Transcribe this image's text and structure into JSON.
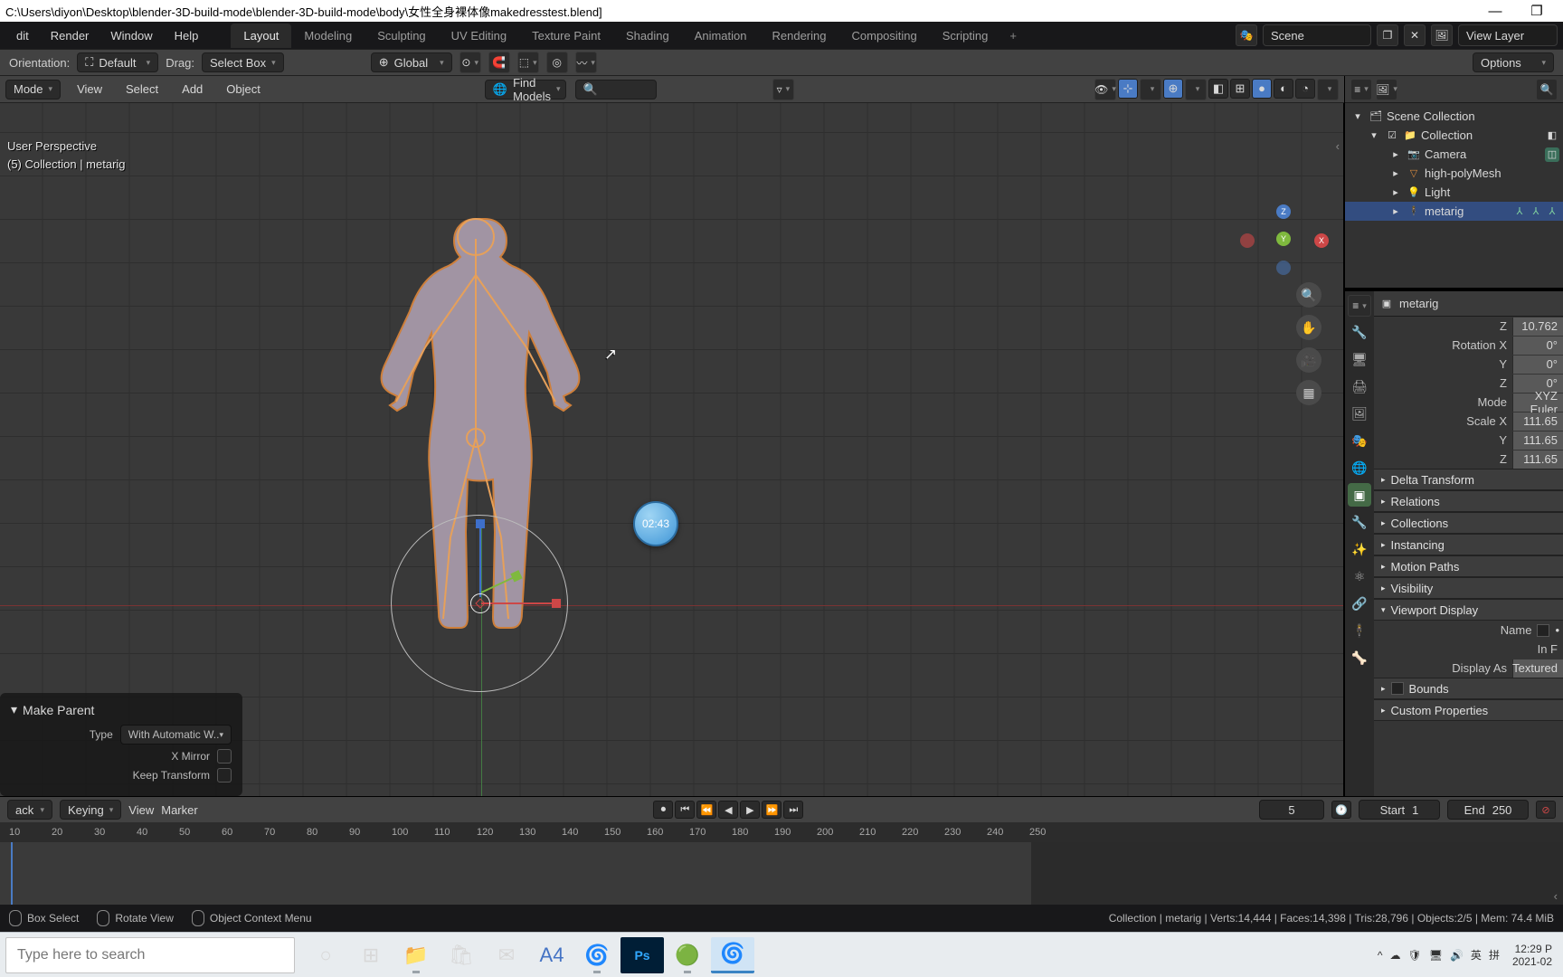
{
  "titlebar": {
    "path": "C:\\Users\\diyon\\Desktop\\blender-3D-build-mode\\blender-3D-build-mode\\body\\女性全身裸体像makedresstest.blend]",
    "minimize": "—",
    "maximize": "❐"
  },
  "topmenu": {
    "items": [
      "dit",
      "Render",
      "Window",
      "Help"
    ],
    "workspaces": [
      "Layout",
      "Modeling",
      "Sculpting",
      "UV Editing",
      "Texture Paint",
      "Shading",
      "Animation",
      "Rendering",
      "Compositing",
      "Scripting"
    ],
    "ws_add": "+",
    "scene_label": "Scene",
    "layer_label": "View Layer"
  },
  "toolsettings": {
    "orientation_label": "Orientation:",
    "orientation_value": "Default",
    "drag_label": "Drag:",
    "drag_value": "Select Box",
    "transform_value": "Global",
    "options_label": "Options"
  },
  "viewport_header": {
    "mode": "Mode",
    "menus": [
      "View",
      "Select",
      "Add",
      "Object"
    ],
    "find_label": "Find Models"
  },
  "viewport": {
    "persp": "User Perspective",
    "context": "(5) Collection | metarig",
    "timer": "02:43"
  },
  "nav_axes": {
    "x": "X",
    "y": "Y",
    "z": "Z"
  },
  "op_panel": {
    "title": "Make Parent",
    "type_label": "Type",
    "type_value": "With Automatic W..",
    "xmirror_label": "X Mirror",
    "keep_label": "Keep Transform"
  },
  "outliner": {
    "root": "Scene Collection",
    "coll": "Collection",
    "items": [
      {
        "name": "Camera",
        "icon": "camera"
      },
      {
        "name": "high-polyMesh",
        "icon": "mesh"
      },
      {
        "name": "Light",
        "icon": "light"
      },
      {
        "name": "metarig",
        "icon": "armature",
        "selected": true
      }
    ]
  },
  "properties": {
    "object_name": "metarig",
    "z_label": "Z",
    "z_value": "10.762",
    "rotx_label": "Rotation X",
    "rotx_value": "0°",
    "roty_label": "Y",
    "roty_value": "0°",
    "rotz_label": "Z",
    "rotz_value": "0°",
    "mode_label": "Mode",
    "mode_value": "XYZ Euler",
    "scalex_label": "Scale X",
    "scalex_value": "111.65",
    "scaley_label": "Y",
    "scaley_value": "111.65",
    "scalez_label": "Z",
    "scalez_value": "111.65",
    "sections": [
      "Delta Transform",
      "Relations",
      "Collections",
      "Instancing",
      "Motion Paths",
      "Visibility",
      "Viewport Display"
    ],
    "name_label": "Name",
    "inf_label": "In F",
    "display_as_label": "Display As",
    "display_as_value": "Textured",
    "bounds_label": "Bounds",
    "custom_props_label": "Custom Properties"
  },
  "timeline": {
    "menus": [
      "ack",
      "Keying",
      "View",
      "Marker"
    ],
    "current": "5",
    "start_label": "Start",
    "start_value": "1",
    "end_label": "End",
    "end_value": "250",
    "ticks": [
      "10",
      "20",
      "30",
      "40",
      "50",
      "60",
      "70",
      "80",
      "90",
      "100",
      "110",
      "120",
      "130",
      "140",
      "150",
      "160",
      "170",
      "180",
      "190",
      "200",
      "210",
      "220",
      "230",
      "240",
      "250"
    ]
  },
  "statusbar": {
    "hints": [
      "Box Select",
      "Rotate View",
      "Object Context Menu"
    ],
    "stats": "Collection | metarig | Verts:14,444 | Faces:14,398 | Tris:28,796 | Objects:2/5 | Mem: 74.4 MiB"
  },
  "taskbar": {
    "search_placeholder": "Type here to search",
    "tray_ime": "英",
    "tray_ime2": "拼",
    "time": "12:29 P",
    "date": "2021-02"
  }
}
